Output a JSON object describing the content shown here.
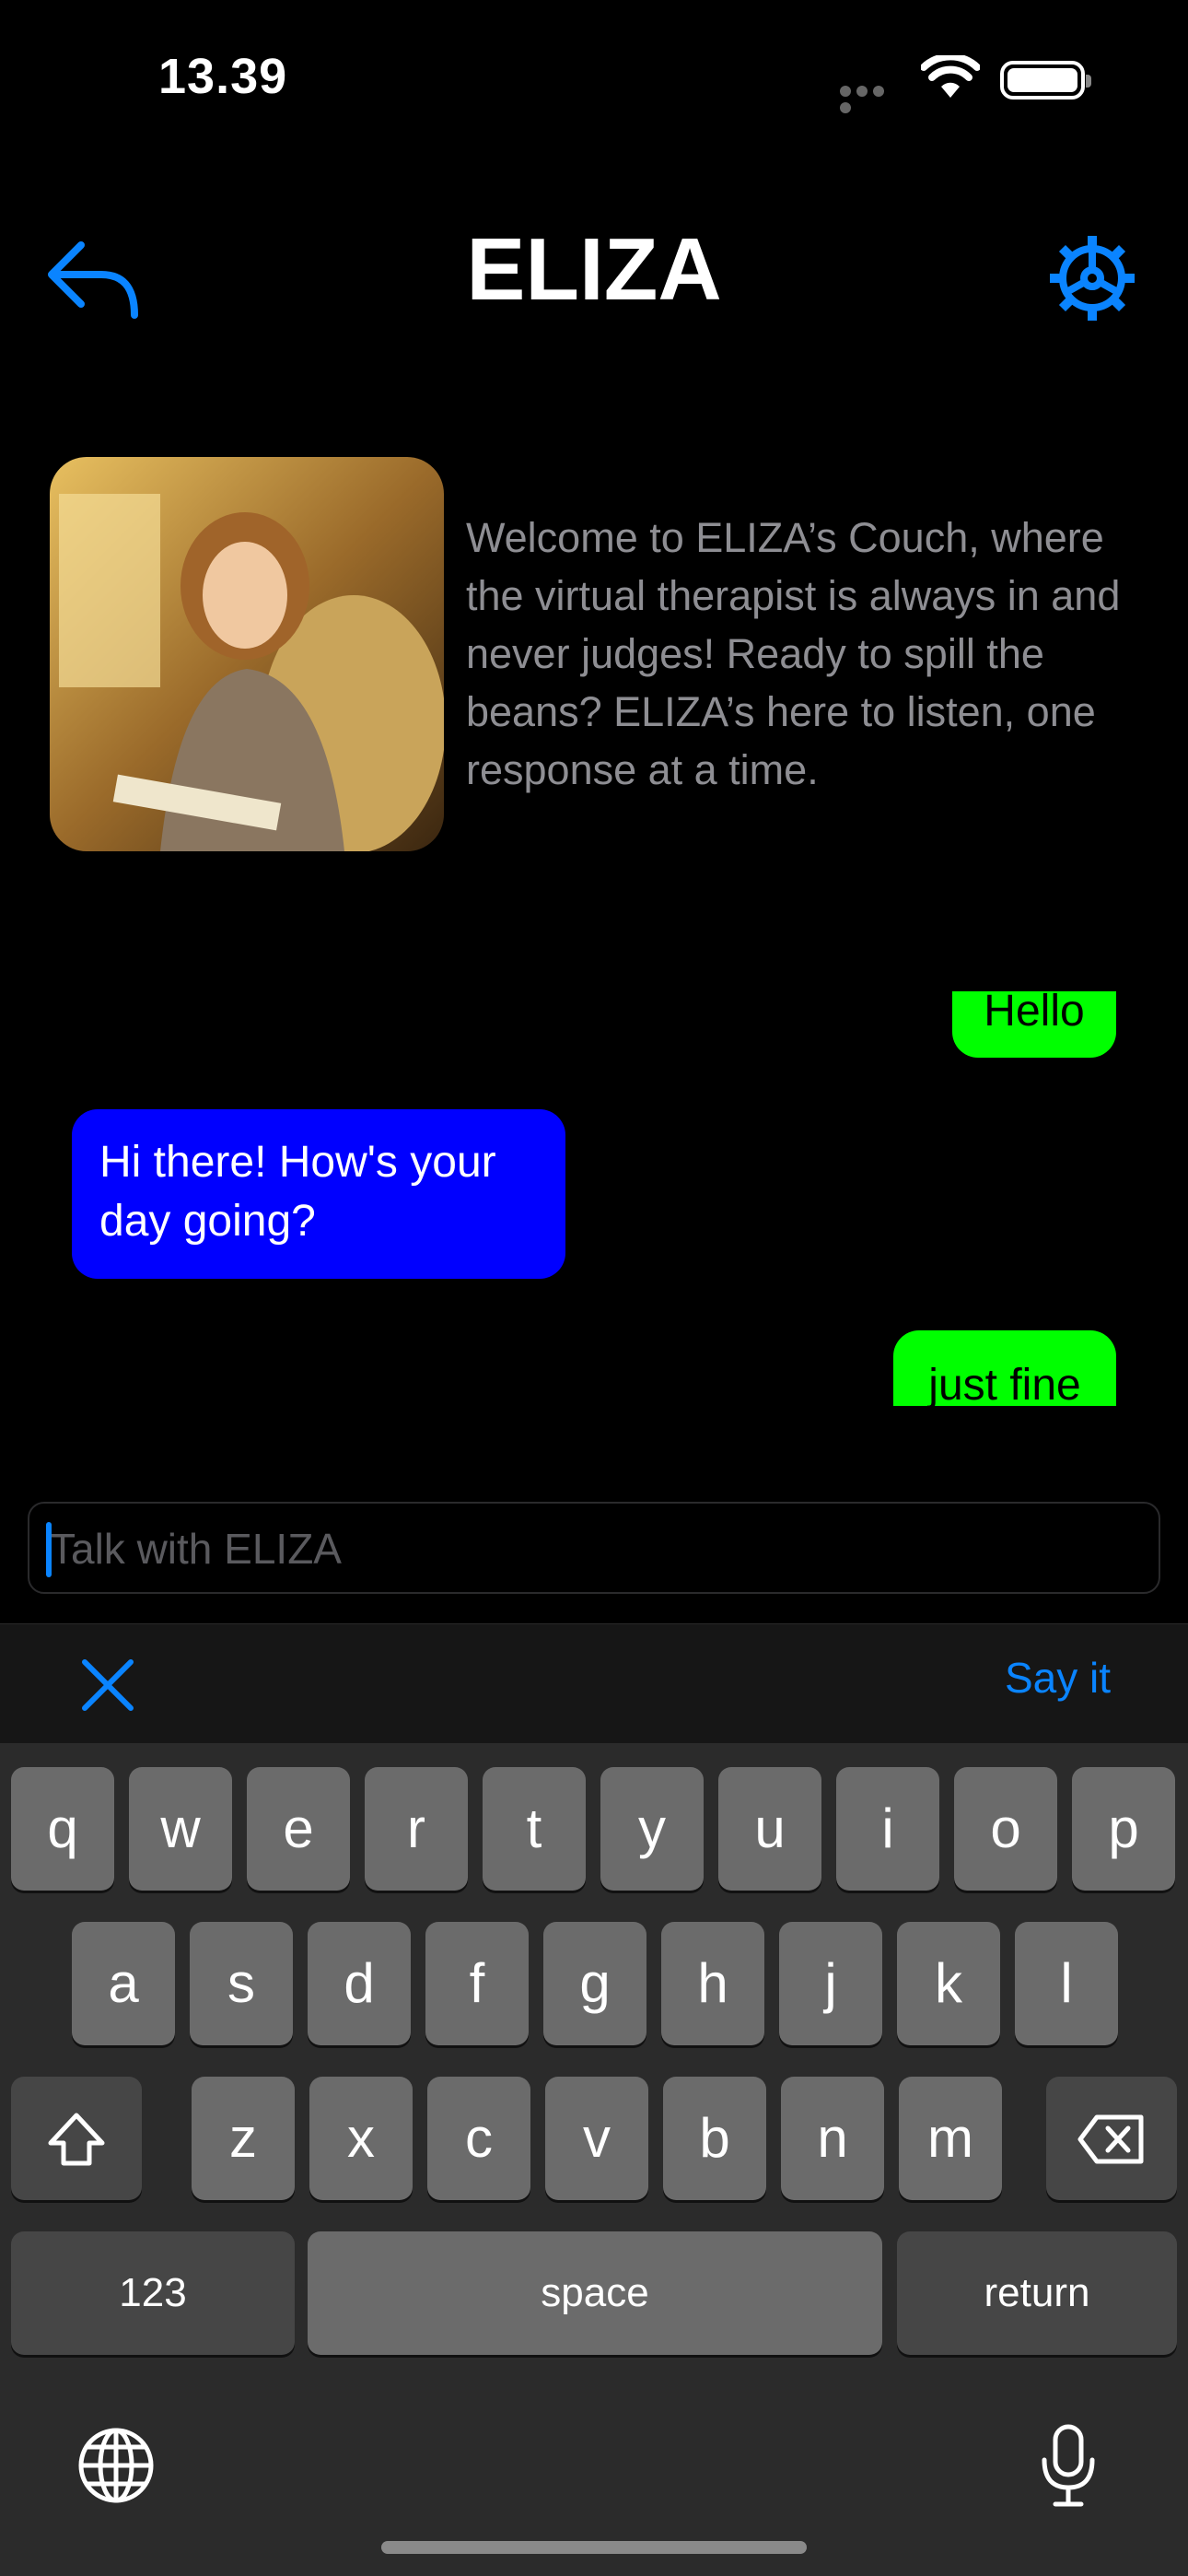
{
  "status_bar": {
    "time": "13.39"
  },
  "header": {
    "title": "ELIZA",
    "back_icon": "reply-arrow-icon",
    "settings_icon": "gear-icon",
    "accent_color": "#0a84ff"
  },
  "intro": {
    "avatar": "therapist-portrait-image",
    "welcome_text": "Welcome to ELIZA’s Couch, where the virtual therapist is always in and never judges! Ready to spill the beans? ELIZA’s here to listen, one response at a time."
  },
  "chat": {
    "user_bubble_color": "#00ff00",
    "bot_bubble_color": "#0000ff",
    "messages": [
      {
        "sender": "user",
        "text": "Hello"
      },
      {
        "sender": "bot",
        "text": "Hi there! How's your day going?"
      },
      {
        "sender": "user",
        "text": "just fine"
      }
    ]
  },
  "input": {
    "placeholder": "Talk with ELIZA",
    "value": ""
  },
  "accessory": {
    "close_icon": "close-icon",
    "say_label": "Say it"
  },
  "keyboard": {
    "row1": [
      "q",
      "w",
      "e",
      "r",
      "t",
      "y",
      "u",
      "i",
      "o",
      "p"
    ],
    "row2": [
      "a",
      "s",
      "d",
      "f",
      "g",
      "h",
      "j",
      "k",
      "l"
    ],
    "row3": [
      "z",
      "x",
      "c",
      "v",
      "b",
      "n",
      "m"
    ],
    "numbers_label": "123",
    "space_label": "space",
    "return_label": "return",
    "shift_icon": "shift-icon",
    "delete_icon": "delete-icon",
    "globe_icon": "globe-icon",
    "mic_icon": "microphone-icon"
  }
}
